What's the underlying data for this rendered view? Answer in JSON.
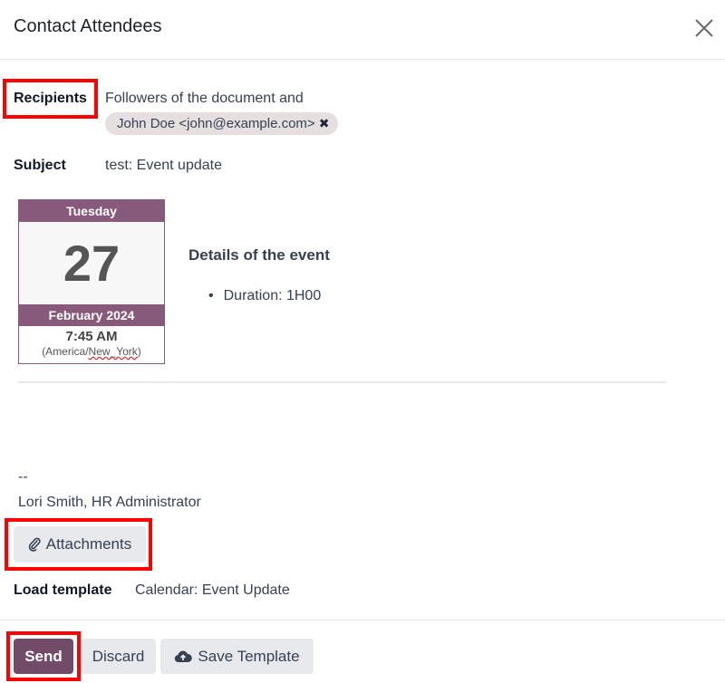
{
  "dialog": {
    "title": "Contact Attendees",
    "close_icon": "close-icon"
  },
  "recipients": {
    "label": "Recipients",
    "text": "Followers of the document and",
    "tags": [
      {
        "label": "John Doe <john@example.com>",
        "remove_icon": "✖"
      }
    ]
  },
  "subject": {
    "label": "Subject",
    "value": "test: Event update"
  },
  "calendar": {
    "weekday": "Tuesday",
    "day": "27",
    "month_year": "February 2024",
    "time": "7:45 AM",
    "tz_prefix": "(America/",
    "tz_city": "New_York",
    "tz_suffix": ")"
  },
  "details": {
    "title": "Details of the event",
    "items": [
      "Duration: 1H00"
    ]
  },
  "signature": {
    "separator": "--",
    "name": "Lori Smith, HR Administrator"
  },
  "attachments": {
    "label": "Attachments",
    "icon": "paperclip-icon"
  },
  "template": {
    "label": "Load template",
    "value": "Calendar: Event Update"
  },
  "footer": {
    "send": "Send",
    "discard": "Discard",
    "save_template": "Save Template",
    "save_icon": "cloud-upload-icon"
  },
  "colors": {
    "primary": "#714b67",
    "calendar_band": "#875a7b",
    "highlight": "#ff0000"
  }
}
